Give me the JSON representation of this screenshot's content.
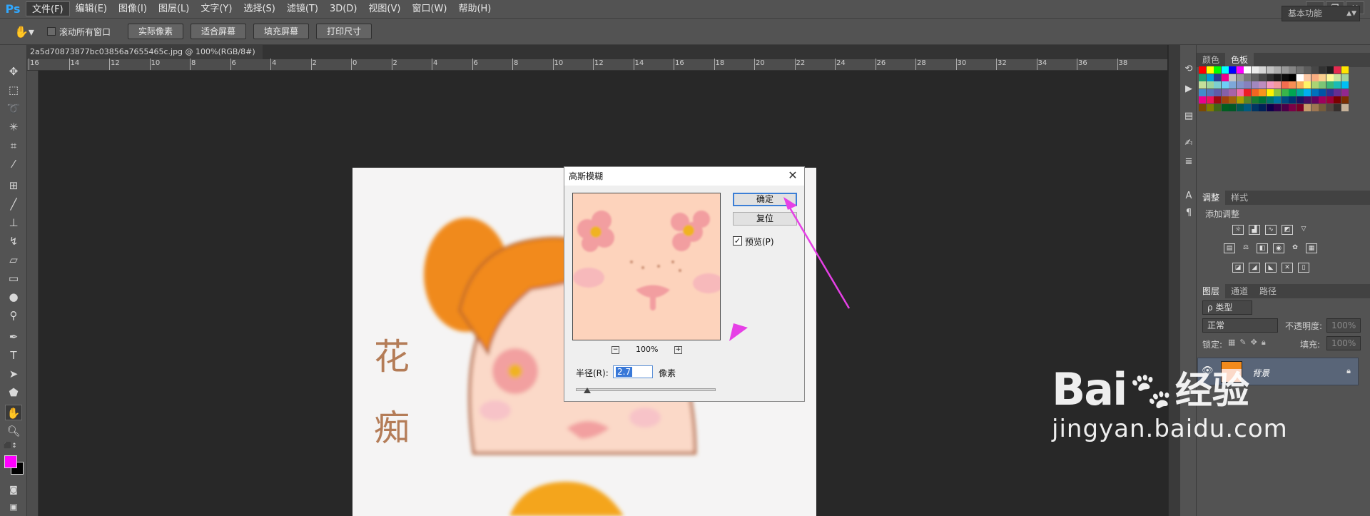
{
  "menubar": {
    "logo": "Ps",
    "items": [
      "文件(F)",
      "编辑(E)",
      "图像(I)",
      "图层(L)",
      "文字(Y)",
      "选择(S)",
      "滤镜(T)",
      "3D(D)",
      "视图(V)",
      "窗口(W)",
      "帮助(H)"
    ],
    "window_controls": [
      "▁",
      "❐",
      "✕"
    ]
  },
  "options": {
    "scroll_all": "滚动所有窗口",
    "buttons": [
      "实际像素",
      "适合屏幕",
      "填充屏幕",
      "打印尺寸"
    ],
    "workspace": "基本功能"
  },
  "document": {
    "tab_title": "2a5d70873877bc03856a7655465c.jpg @ 100%(RGB/8#)",
    "close": "×",
    "ruler_labels": [
      "16",
      "14",
      "12",
      "10",
      "8",
      "6",
      "4",
      "2",
      "0",
      "2",
      "4",
      "6",
      "8",
      "10",
      "12",
      "14",
      "16",
      "18",
      "20",
      "22",
      "24",
      "26",
      "28",
      "30",
      "32",
      "34",
      "36",
      "38"
    ],
    "image_text": [
      "花",
      "痴"
    ]
  },
  "panels": {
    "swatch_tabs": [
      "颜色",
      "色板"
    ],
    "adjust_tabs": [
      "调整",
      "样式"
    ],
    "adjust_title": "添加调整",
    "layer_tabs": [
      "图层",
      "通道",
      "路径"
    ],
    "kind_filter": "ρ 类型",
    "blend_mode": "正常",
    "opacity_label": "不透明度:",
    "opacity_value": "100%",
    "lock_label": "锁定:",
    "fill_label": "填充:",
    "fill_value": "100%",
    "layer_name": "背景"
  },
  "dialog": {
    "title": "高斯模糊",
    "ok": "确定",
    "reset": "复位",
    "preview_label": "预览(P)",
    "preview_checked": true,
    "zoom": "100%",
    "zoom_minus": "−",
    "zoom_plus": "+",
    "radius_label": "半径(R):",
    "radius_value": "2.7",
    "unit": "像素",
    "slider_fraction": 0.08
  },
  "watermark": {
    "brand": "Bai",
    "brand_cn": "经验",
    "url": "jingyan.baidu.com"
  },
  "colors": {
    "fg": "#ff00ff",
    "bg": "#000000",
    "accent_arrow": "#e640e6"
  }
}
